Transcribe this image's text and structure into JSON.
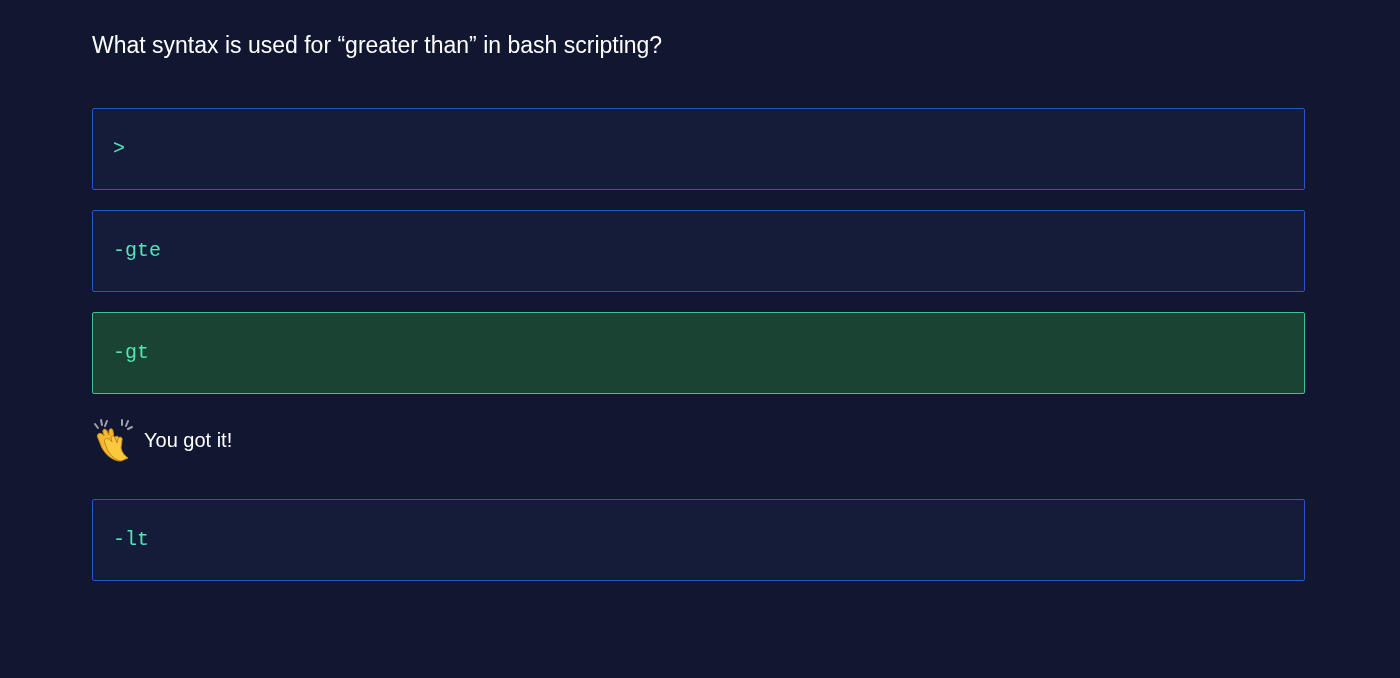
{
  "question": "What syntax is used for “greater than” in bash scripting?",
  "options": [
    {
      "text": ">",
      "selected": false
    },
    {
      "text": "-gte",
      "selected": false
    },
    {
      "text": "-gt",
      "selected": true
    },
    {
      "text": "-lt",
      "selected": false
    }
  ],
  "feedback": {
    "kind": "correct",
    "text": "You got it!"
  }
}
